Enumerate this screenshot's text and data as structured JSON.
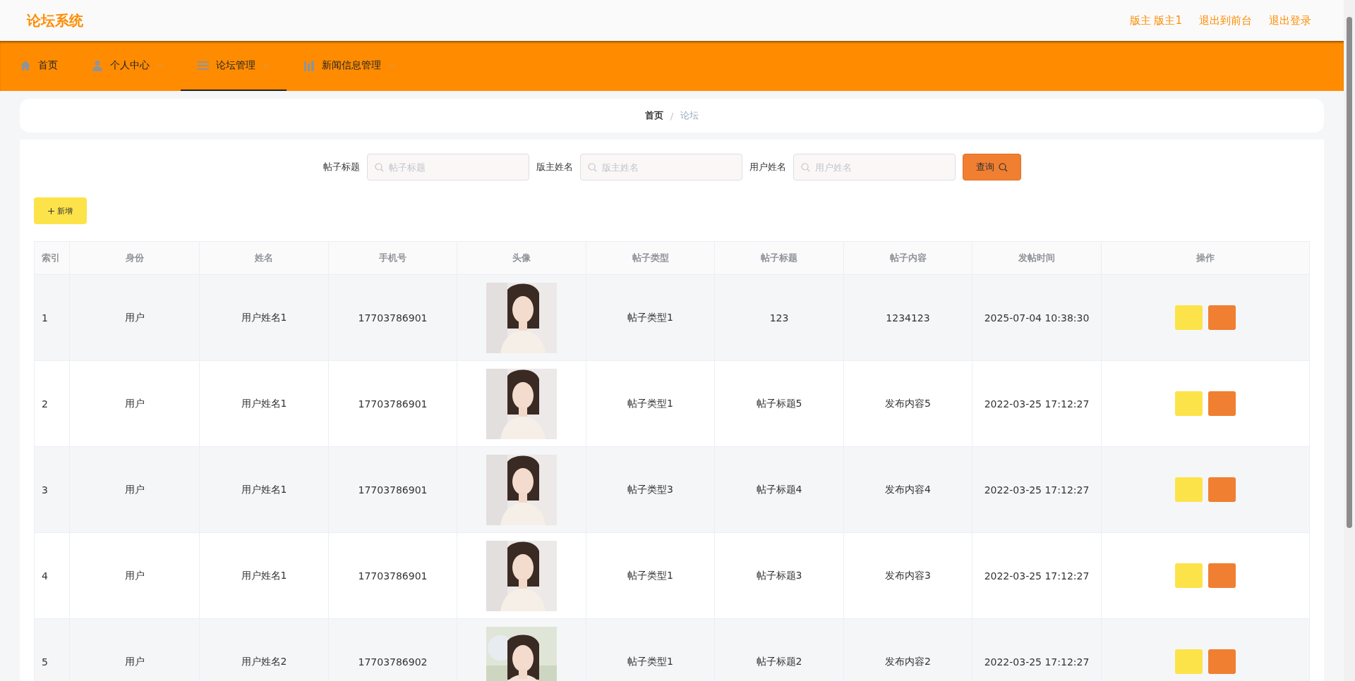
{
  "header": {
    "title": "论坛系统",
    "links": [
      "版主 版主1",
      "退出到前台",
      "退出登录"
    ]
  },
  "nav": [
    {
      "label": "首页",
      "dropdown": false,
      "selected": false
    },
    {
      "label": "个人中心",
      "dropdown": true,
      "selected": false
    },
    {
      "label": "论坛管理",
      "dropdown": true,
      "selected": true
    },
    {
      "label": "新闻信息管理",
      "dropdown": true,
      "selected": false
    }
  ],
  "breadcrumb": {
    "items": [
      "首页",
      "论坛"
    ],
    "separator": "/"
  },
  "search": {
    "fields": [
      {
        "label": "帖子标题",
        "placeholder": "帖子标题"
      },
      {
        "label": "版主姓名",
        "placeholder": "版主姓名"
      },
      {
        "label": "用户姓名",
        "placeholder": "用户姓名"
      }
    ],
    "button": "查询"
  },
  "add_button": "新增",
  "table": {
    "columns": [
      "索引",
      "身份",
      "姓名",
      "手机号",
      "头像",
      "帖子类型",
      "帖子标题",
      "帖子内容",
      "发帖时间",
      "操作"
    ],
    "rows": [
      {
        "cells": [
          "1",
          "用户",
          "用户姓名1",
          "17703786901",
          {
            "kind": "picture"
          },
          "帖子类型1",
          "123",
          "1234123",
          "2025-07-04 10:38:30"
        ]
      },
      {
        "cells": [
          "2",
          "用户",
          "用户姓名1",
          "17703786901",
          {
            "kind": "picture"
          },
          "帖子类型1",
          "帖子标题5",
          "发布内容5",
          "2022-03-25 17:12:27"
        ]
      },
      {
        "cells": [
          "3",
          "用户",
          "用户姓名1",
          "17703786901",
          {
            "kind": "picture"
          },
          "帖子类型3",
          "帖子标题4",
          "发布内容4",
          "2022-03-25 17:12:27"
        ]
      },
      {
        "cells": [
          "4",
          "用户",
          "用户姓名1",
          "17703786901",
          {
            "kind": "picture"
          },
          "帖子类型1",
          "帖子标题3",
          "发布内容3",
          "2022-03-25 17:12:27"
        ]
      },
      {
        "cells": [
          "5",
          "用户",
          "用户姓名2",
          "17703786902",
          {
            "kind": "picture"
          },
          "帖子类型1",
          "帖子标题2",
          "发布内容2",
          "2022-03-25 17:12:27"
        ]
      }
    ]
  }
}
